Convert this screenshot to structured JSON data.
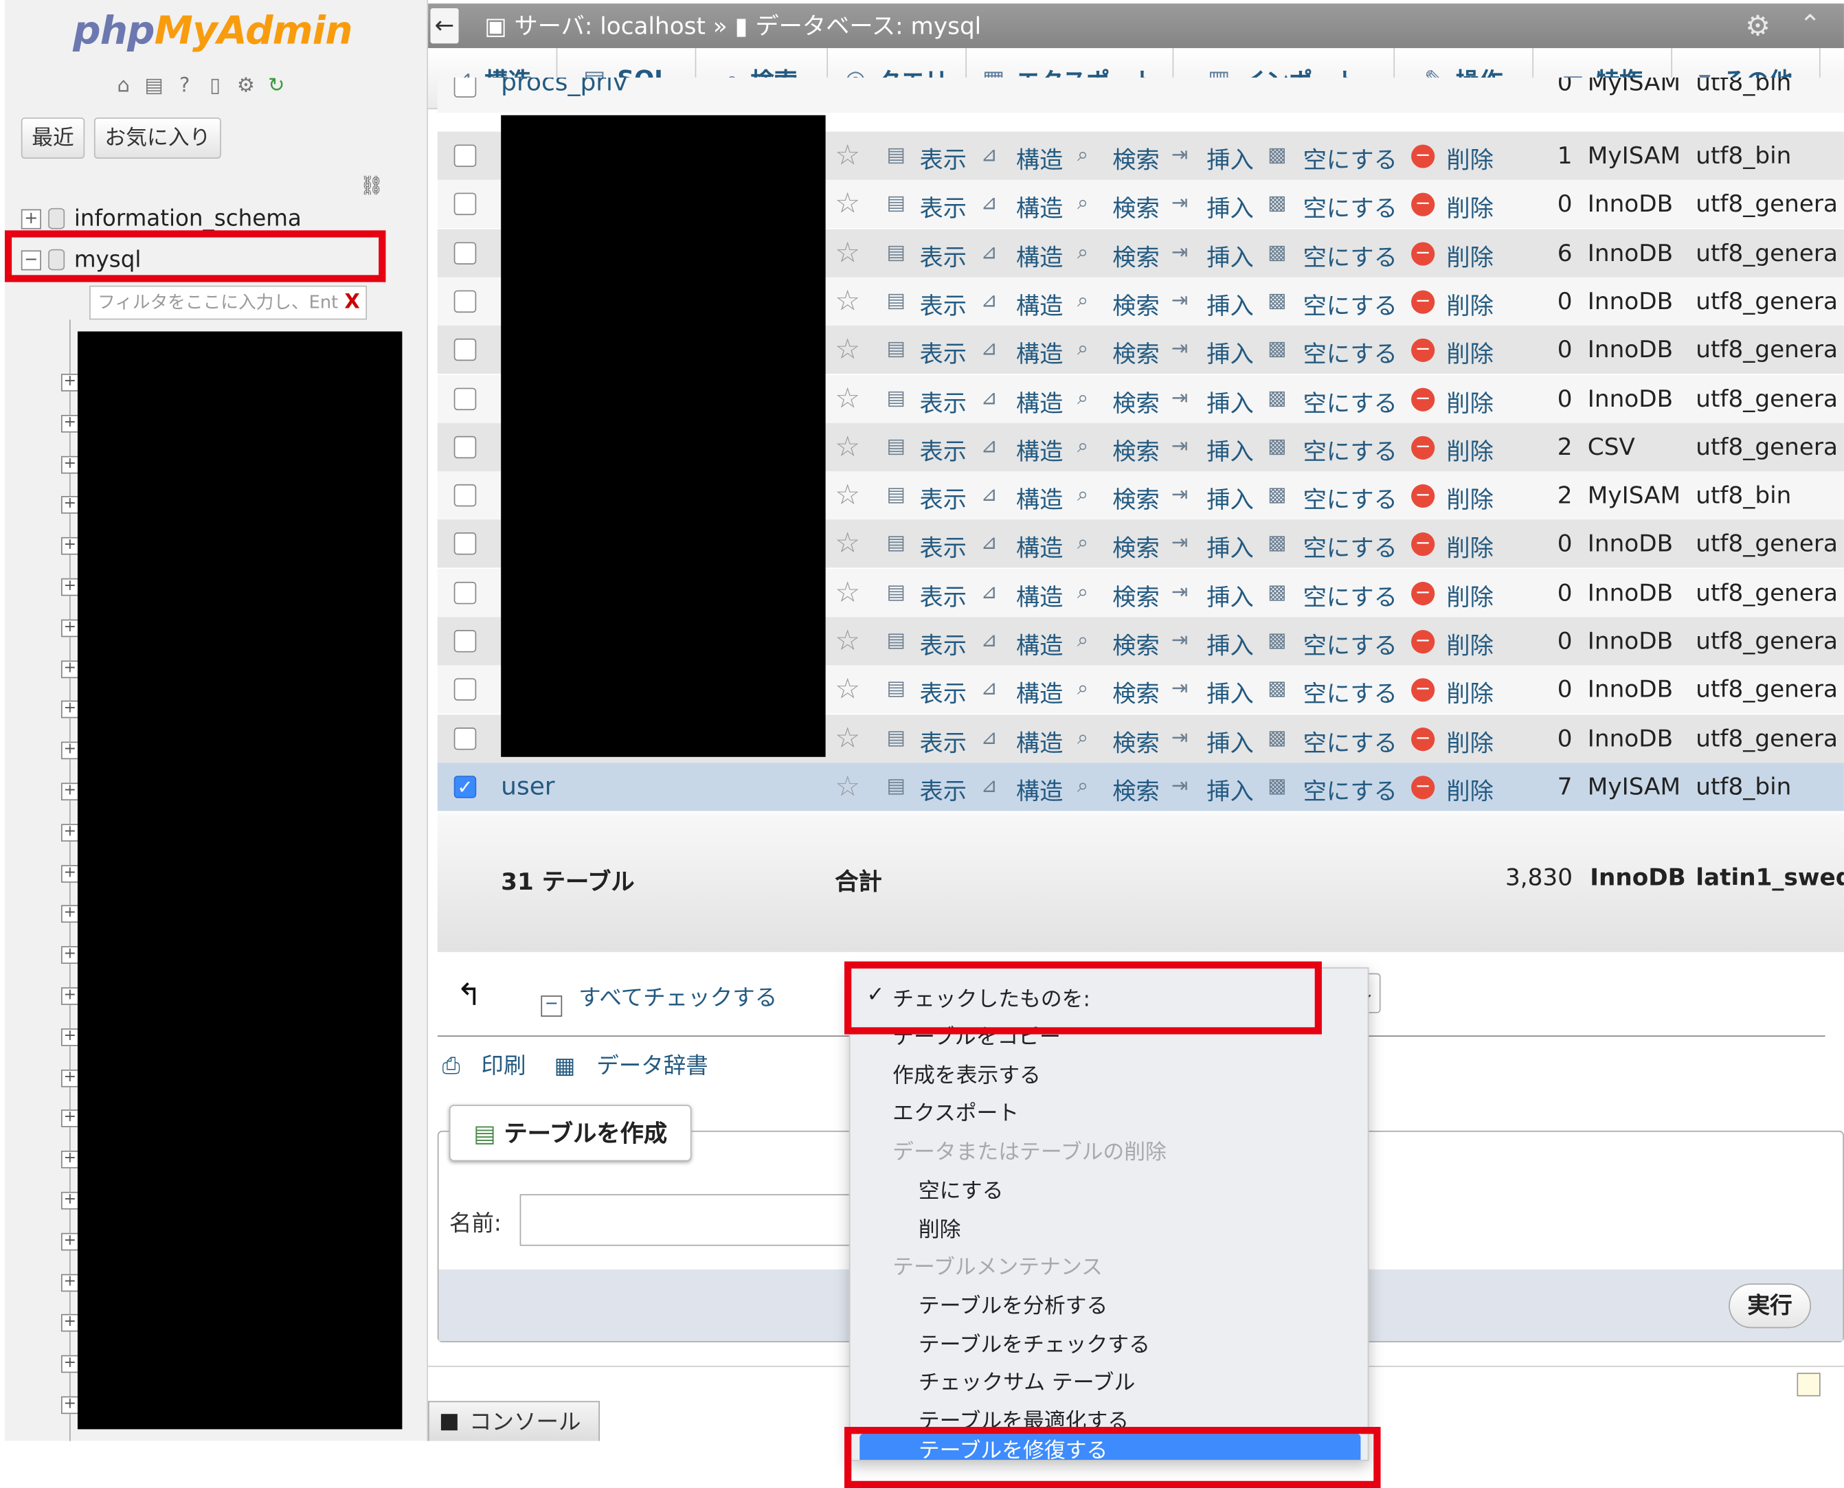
{
  "app": {
    "logo_php": "php",
    "logo_ma": "MyAdmin",
    "recent_btn": "最近",
    "favorites_btn": "お気に入り"
  },
  "sidebar": {
    "databases": [
      {
        "name": "information_schema",
        "expanded": false
      },
      {
        "name": "mysql",
        "expanded": true
      }
    ],
    "filter_placeholder": "フィルタをここに入力し、Ent",
    "filter_clear": "X"
  },
  "breadcrumb": {
    "server": "サーバ: localhost",
    "sep": "»",
    "database": "データベース: mysql"
  },
  "tabs": [
    {
      "label": "構造",
      "icon": "structure-icon"
    },
    {
      "label": "SQL",
      "icon": "sql-icon"
    },
    {
      "label": "検索",
      "icon": "search-icon"
    },
    {
      "label": "クエリ",
      "icon": "query-icon"
    },
    {
      "label": "エクスポート",
      "icon": "export-icon"
    },
    {
      "label": "インポート",
      "icon": "import-icon"
    },
    {
      "label": "操作",
      "icon": "wrench-icon"
    },
    {
      "label": "特権",
      "icon": "privileges-icon"
    },
    {
      "label": "その他",
      "icon": "chevron-down-icon"
    }
  ],
  "actions": {
    "browse": "表示",
    "structure": "構造",
    "search": "検索",
    "insert": "挿入",
    "empty": "空にする",
    "drop": "削除"
  },
  "partial_first_row": {
    "name": "procs_priv",
    "rows": "0",
    "engine": "MyISAM",
    "collation": "utf8_bin"
  },
  "tables": [
    {
      "name": "",
      "rows": "1",
      "engine": "MyISAM",
      "collation": "utf8_bin",
      "checked": false
    },
    {
      "name": "",
      "rows": "0",
      "engine": "InnoDB",
      "collation": "utf8_genera",
      "checked": false
    },
    {
      "name": "",
      "rows": "6",
      "engine": "InnoDB",
      "collation": "utf8_genera",
      "checked": false
    },
    {
      "name": "",
      "rows": "0",
      "engine": "InnoDB",
      "collation": "utf8_genera",
      "checked": false
    },
    {
      "name": "",
      "rows": "0",
      "engine": "InnoDB",
      "collation": "utf8_genera",
      "checked": false
    },
    {
      "name": "",
      "rows": "0",
      "engine": "InnoDB",
      "collation": "utf8_genera",
      "checked": false
    },
    {
      "name": "",
      "rows": "2",
      "engine": "CSV",
      "collation": "utf8_genera",
      "checked": false
    },
    {
      "name": "",
      "rows": "2",
      "engine": "MyISAM",
      "collation": "utf8_bin",
      "checked": false
    },
    {
      "name": "",
      "rows": "0",
      "engine": "InnoDB",
      "collation": "utf8_genera",
      "checked": false
    },
    {
      "name": "",
      "rows": "0",
      "engine": "InnoDB",
      "collation": "utf8_genera",
      "checked": false
    },
    {
      "name": "",
      "rows": "0",
      "engine": "InnoDB",
      "collation": "utf8_genera",
      "checked": false
    },
    {
      "name": "",
      "rows": "0",
      "engine": "InnoDB",
      "collation": "utf8_genera",
      "checked": false
    },
    {
      "name": "",
      "rows": "0",
      "engine": "InnoDB",
      "collation": "utf8_genera",
      "checked": false
    },
    {
      "name": "user",
      "rows": "7",
      "engine": "MyISAM",
      "collation": "utf8_bin",
      "checked": true
    }
  ],
  "totals": {
    "table_count": "31 テーブル",
    "sum_label": "合計",
    "rows": "3,830",
    "engine": "InnoDB",
    "collation": "latin1_swed"
  },
  "bulk": {
    "check_all": "すべてチェックする",
    "print": "印刷",
    "data_dictionary": "データ辞書"
  },
  "dropdown": {
    "selected": "チェックしたものを:",
    "items": [
      {
        "label": "テーブルをコピー",
        "type": "item"
      },
      {
        "label": "作成を表示する",
        "type": "item"
      },
      {
        "label": "エクスポート",
        "type": "item"
      },
      {
        "label": "データまたはテーブルの削除",
        "type": "group"
      },
      {
        "label": "空にする",
        "type": "sub"
      },
      {
        "label": "削除",
        "type": "sub"
      },
      {
        "label": "テーブルメンテナンス",
        "type": "group"
      },
      {
        "label": "テーブルを分析する",
        "type": "sub"
      },
      {
        "label": "テーブルをチェックする",
        "type": "sub"
      },
      {
        "label": "チェックサム テーブル",
        "type": "sub"
      },
      {
        "label": "テーブルを最適化する",
        "type": "sub"
      },
      {
        "label": "テーブルを修復する",
        "type": "highlight"
      }
    ]
  },
  "create_table": {
    "button": "テーブルを作成",
    "name_label": "名前:",
    "go": "実行"
  },
  "console": {
    "label": "コンソール"
  },
  "colors": {
    "link": "#235a81",
    "highlight": "#3d8bfd",
    "annotation_red": "#e60012",
    "selected_row": "#c8d7e8"
  }
}
